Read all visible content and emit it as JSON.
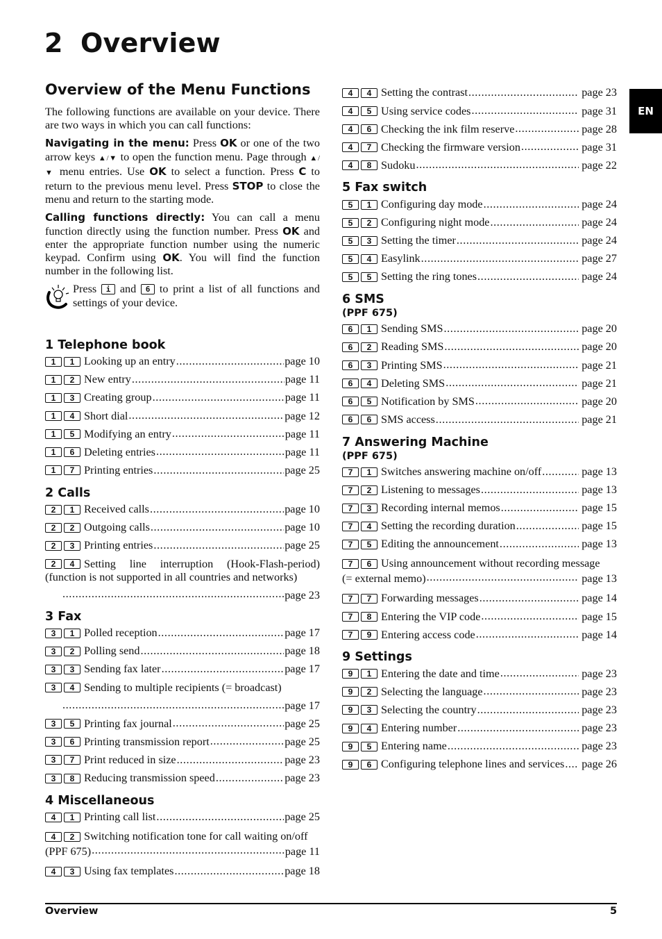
{
  "chapter": {
    "number": "2",
    "title": "Overview"
  },
  "language_tab": "EN",
  "section_title": "Overview of the Menu Functions",
  "intro": "The following functions are available on your device. There are two ways in which you can call functions:",
  "navigating": {
    "label": "Navigating in the menu:",
    "t1": " Press ",
    "ok1": "OK",
    "t2": " or one of the two arrow keys ",
    "arrows1": "▲/▼",
    "t3": " to open the function menu. Page through ",
    "arrows2": "▲/▼",
    "t4": " menu entries. Use ",
    "ok2": "OK",
    "t5": " to select a function. Press ",
    "c": "C",
    "t6": " to return to the previous menu level. Press ",
    "stop": "STOP",
    "t7": " to close the menu and return to the starting mode."
  },
  "calling": {
    "label": "Calling functions directly:",
    "t1": " You can call a menu function directly using the function number. Press ",
    "ok1": "OK",
    "t2": " and enter the appropriate function number using the numeric keypad. Confirm using ",
    "ok2": "OK",
    "t3": ". You will find the function number in the following list."
  },
  "tip": {
    "icon": "lightbulb-tip-icon",
    "t1": "Press ",
    "key1": "i",
    "t2": " and ",
    "key2": "6",
    "t3": " to print a list of all functions and settings of your device."
  },
  "groups": [
    {
      "title": "1 Telephone book",
      "entries": [
        {
          "keys": [
            "1",
            "1"
          ],
          "label": "Looking up an entry",
          "page": "page 10"
        },
        {
          "keys": [
            "1",
            "2"
          ],
          "label": "New entry",
          "page": "page 11"
        },
        {
          "keys": [
            "1",
            "3"
          ],
          "label": "Creating group",
          "page": "page 11"
        },
        {
          "keys": [
            "1",
            "4"
          ],
          "label": "Short dial",
          "page": "page 12"
        },
        {
          "keys": [
            "1",
            "5"
          ],
          "label": "Modifying an entry",
          "page": "page 11"
        },
        {
          "keys": [
            "1",
            "6"
          ],
          "label": "Deleting entries",
          "page": "page 11"
        },
        {
          "keys": [
            "1",
            "7"
          ],
          "label": "Printing entries",
          "page": "page 25"
        }
      ]
    },
    {
      "title": "2 Calls",
      "entries": [
        {
          "keys": [
            "2",
            "1"
          ],
          "label": "Received calls",
          "page": "page 10"
        },
        {
          "keys": [
            "2",
            "2"
          ],
          "label": "Outgoing calls",
          "page": "page 10"
        },
        {
          "keys": [
            "2",
            "3"
          ],
          "label": "Printing entries",
          "page": "page 25"
        },
        {
          "keys": [
            "2",
            "4"
          ],
          "label": "Setting line interruption (Hook-Flash-period) (function is not supported in all countries and networks)",
          "page": "page 23"
        }
      ]
    },
    {
      "title": "3 Fax",
      "entries": [
        {
          "keys": [
            "3",
            "1"
          ],
          "label": "Polled reception",
          "page": "page 17"
        },
        {
          "keys": [
            "3",
            "2"
          ],
          "label": "Polling send",
          "page": "page 18"
        },
        {
          "keys": [
            "3",
            "3"
          ],
          "label": "Sending fax later",
          "page": "page 17"
        },
        {
          "keys": [
            "3",
            "4"
          ],
          "label": "Sending to multiple recipients (= broadcast)",
          "page": "page 17"
        },
        {
          "keys": [
            "3",
            "5"
          ],
          "label": "Printing fax journal",
          "page": "page 25"
        },
        {
          "keys": [
            "3",
            "6"
          ],
          "label": "Printing transmission report",
          "page": "page 25"
        },
        {
          "keys": [
            "3",
            "7"
          ],
          "label": "Print reduced in size",
          "page": "page 23"
        },
        {
          "keys": [
            "3",
            "8"
          ],
          "label": "Reducing transmission speed",
          "page": "page 23"
        }
      ]
    },
    {
      "title": "4 Miscellaneous",
      "entries": [
        {
          "keys": [
            "4",
            "1"
          ],
          "label": "Printing call list",
          "page": "page 25"
        },
        {
          "keys": [
            "4",
            "2"
          ],
          "label": "Switching notification tone for call waiting on/off",
          "label2": "(PPF 675)",
          "page": "page 11"
        },
        {
          "keys": [
            "4",
            "3"
          ],
          "label": "Using fax templates",
          "page": "page 18"
        },
        {
          "keys": [
            "4",
            "4"
          ],
          "label": "Setting the contrast",
          "page": "page 23"
        },
        {
          "keys": [
            "4",
            "5"
          ],
          "label": "Using service codes",
          "page": "page 31"
        },
        {
          "keys": [
            "4",
            "6"
          ],
          "label": "Checking the ink film reserve",
          "page": "page 28"
        },
        {
          "keys": [
            "4",
            "7"
          ],
          "label": "Checking the firmware version",
          "page": "page 31"
        },
        {
          "keys": [
            "4",
            "8"
          ],
          "label": "Sudoku",
          "page": "page 22"
        }
      ]
    },
    {
      "title": "5 Fax switch",
      "entries": [
        {
          "keys": [
            "5",
            "1"
          ],
          "label": "Configuring day mode",
          "page": "page 24"
        },
        {
          "keys": [
            "5",
            "2"
          ],
          "label": "Configuring night mode",
          "page": "page 24"
        },
        {
          "keys": [
            "5",
            "3"
          ],
          "label": "Setting the timer",
          "page": "page 24"
        },
        {
          "keys": [
            "5",
            "4"
          ],
          "label": "Easylink",
          "page": "page 27"
        },
        {
          "keys": [
            "5",
            "5"
          ],
          "label": "Setting the ring tones",
          "page": "page 24"
        }
      ]
    },
    {
      "title": "6 SMS",
      "subtitle": "(PPF 675)",
      "entries": [
        {
          "keys": [
            "6",
            "1"
          ],
          "label": "Sending SMS",
          "page": "page 20"
        },
        {
          "keys": [
            "6",
            "2"
          ],
          "label": "Reading SMS",
          "page": "page 20"
        },
        {
          "keys": [
            "6",
            "3"
          ],
          "label": "Printing SMS",
          "page": "page 21"
        },
        {
          "keys": [
            "6",
            "4"
          ],
          "label": "Deleting SMS",
          "page": "page 21"
        },
        {
          "keys": [
            "6",
            "5"
          ],
          "label": "Notification by SMS",
          "page": "page 20"
        },
        {
          "keys": [
            "6",
            "6"
          ],
          "label": "SMS access",
          "page": "page 21"
        }
      ]
    },
    {
      "title": "7 Answering Machine",
      "subtitle": "(PPF 675)",
      "entries": [
        {
          "keys": [
            "7",
            "1"
          ],
          "label": "Switches answering machine on/off",
          "page": "page 13"
        },
        {
          "keys": [
            "7",
            "2"
          ],
          "label": "Listening to messages",
          "page": "page 13"
        },
        {
          "keys": [
            "7",
            "3"
          ],
          "label": "Recording internal memos",
          "page": "page 15"
        },
        {
          "keys": [
            "7",
            "4"
          ],
          "label": "Setting the recording duration",
          "page": "page 15"
        },
        {
          "keys": [
            "7",
            "5"
          ],
          "label": "Editing the announcement",
          "page": "page 13"
        },
        {
          "keys": [
            "7",
            "6"
          ],
          "label": "Using announcement without recording message",
          "label2": "(= external memo)",
          "page": "page 13"
        },
        {
          "keys": [
            "7",
            "7"
          ],
          "label": "Forwarding messages",
          "page": "page 14"
        },
        {
          "keys": [
            "7",
            "8"
          ],
          "label": "Entering the VIP code",
          "page": "page 15"
        },
        {
          "keys": [
            "7",
            "9"
          ],
          "label": "Entering access code",
          "page": "page 14"
        }
      ]
    },
    {
      "title": "9 Settings",
      "entries": [
        {
          "keys": [
            "9",
            "1"
          ],
          "label": "Entering the date and time",
          "page": "page 23"
        },
        {
          "keys": [
            "9",
            "2"
          ],
          "label": "Selecting the language",
          "page": "page 23"
        },
        {
          "keys": [
            "9",
            "3"
          ],
          "label": "Selecting the country",
          "page": "page 23"
        },
        {
          "keys": [
            "9",
            "4"
          ],
          "label": "Entering number",
          "page": "page 23"
        },
        {
          "keys": [
            "9",
            "5"
          ],
          "label": "Entering name",
          "page": "page 23"
        },
        {
          "keys": [
            "9",
            "6"
          ],
          "label": "Configuring telephone lines and services",
          "page": "page 26"
        }
      ]
    }
  ],
  "footer": {
    "left": "Overview",
    "page_number": "5"
  }
}
